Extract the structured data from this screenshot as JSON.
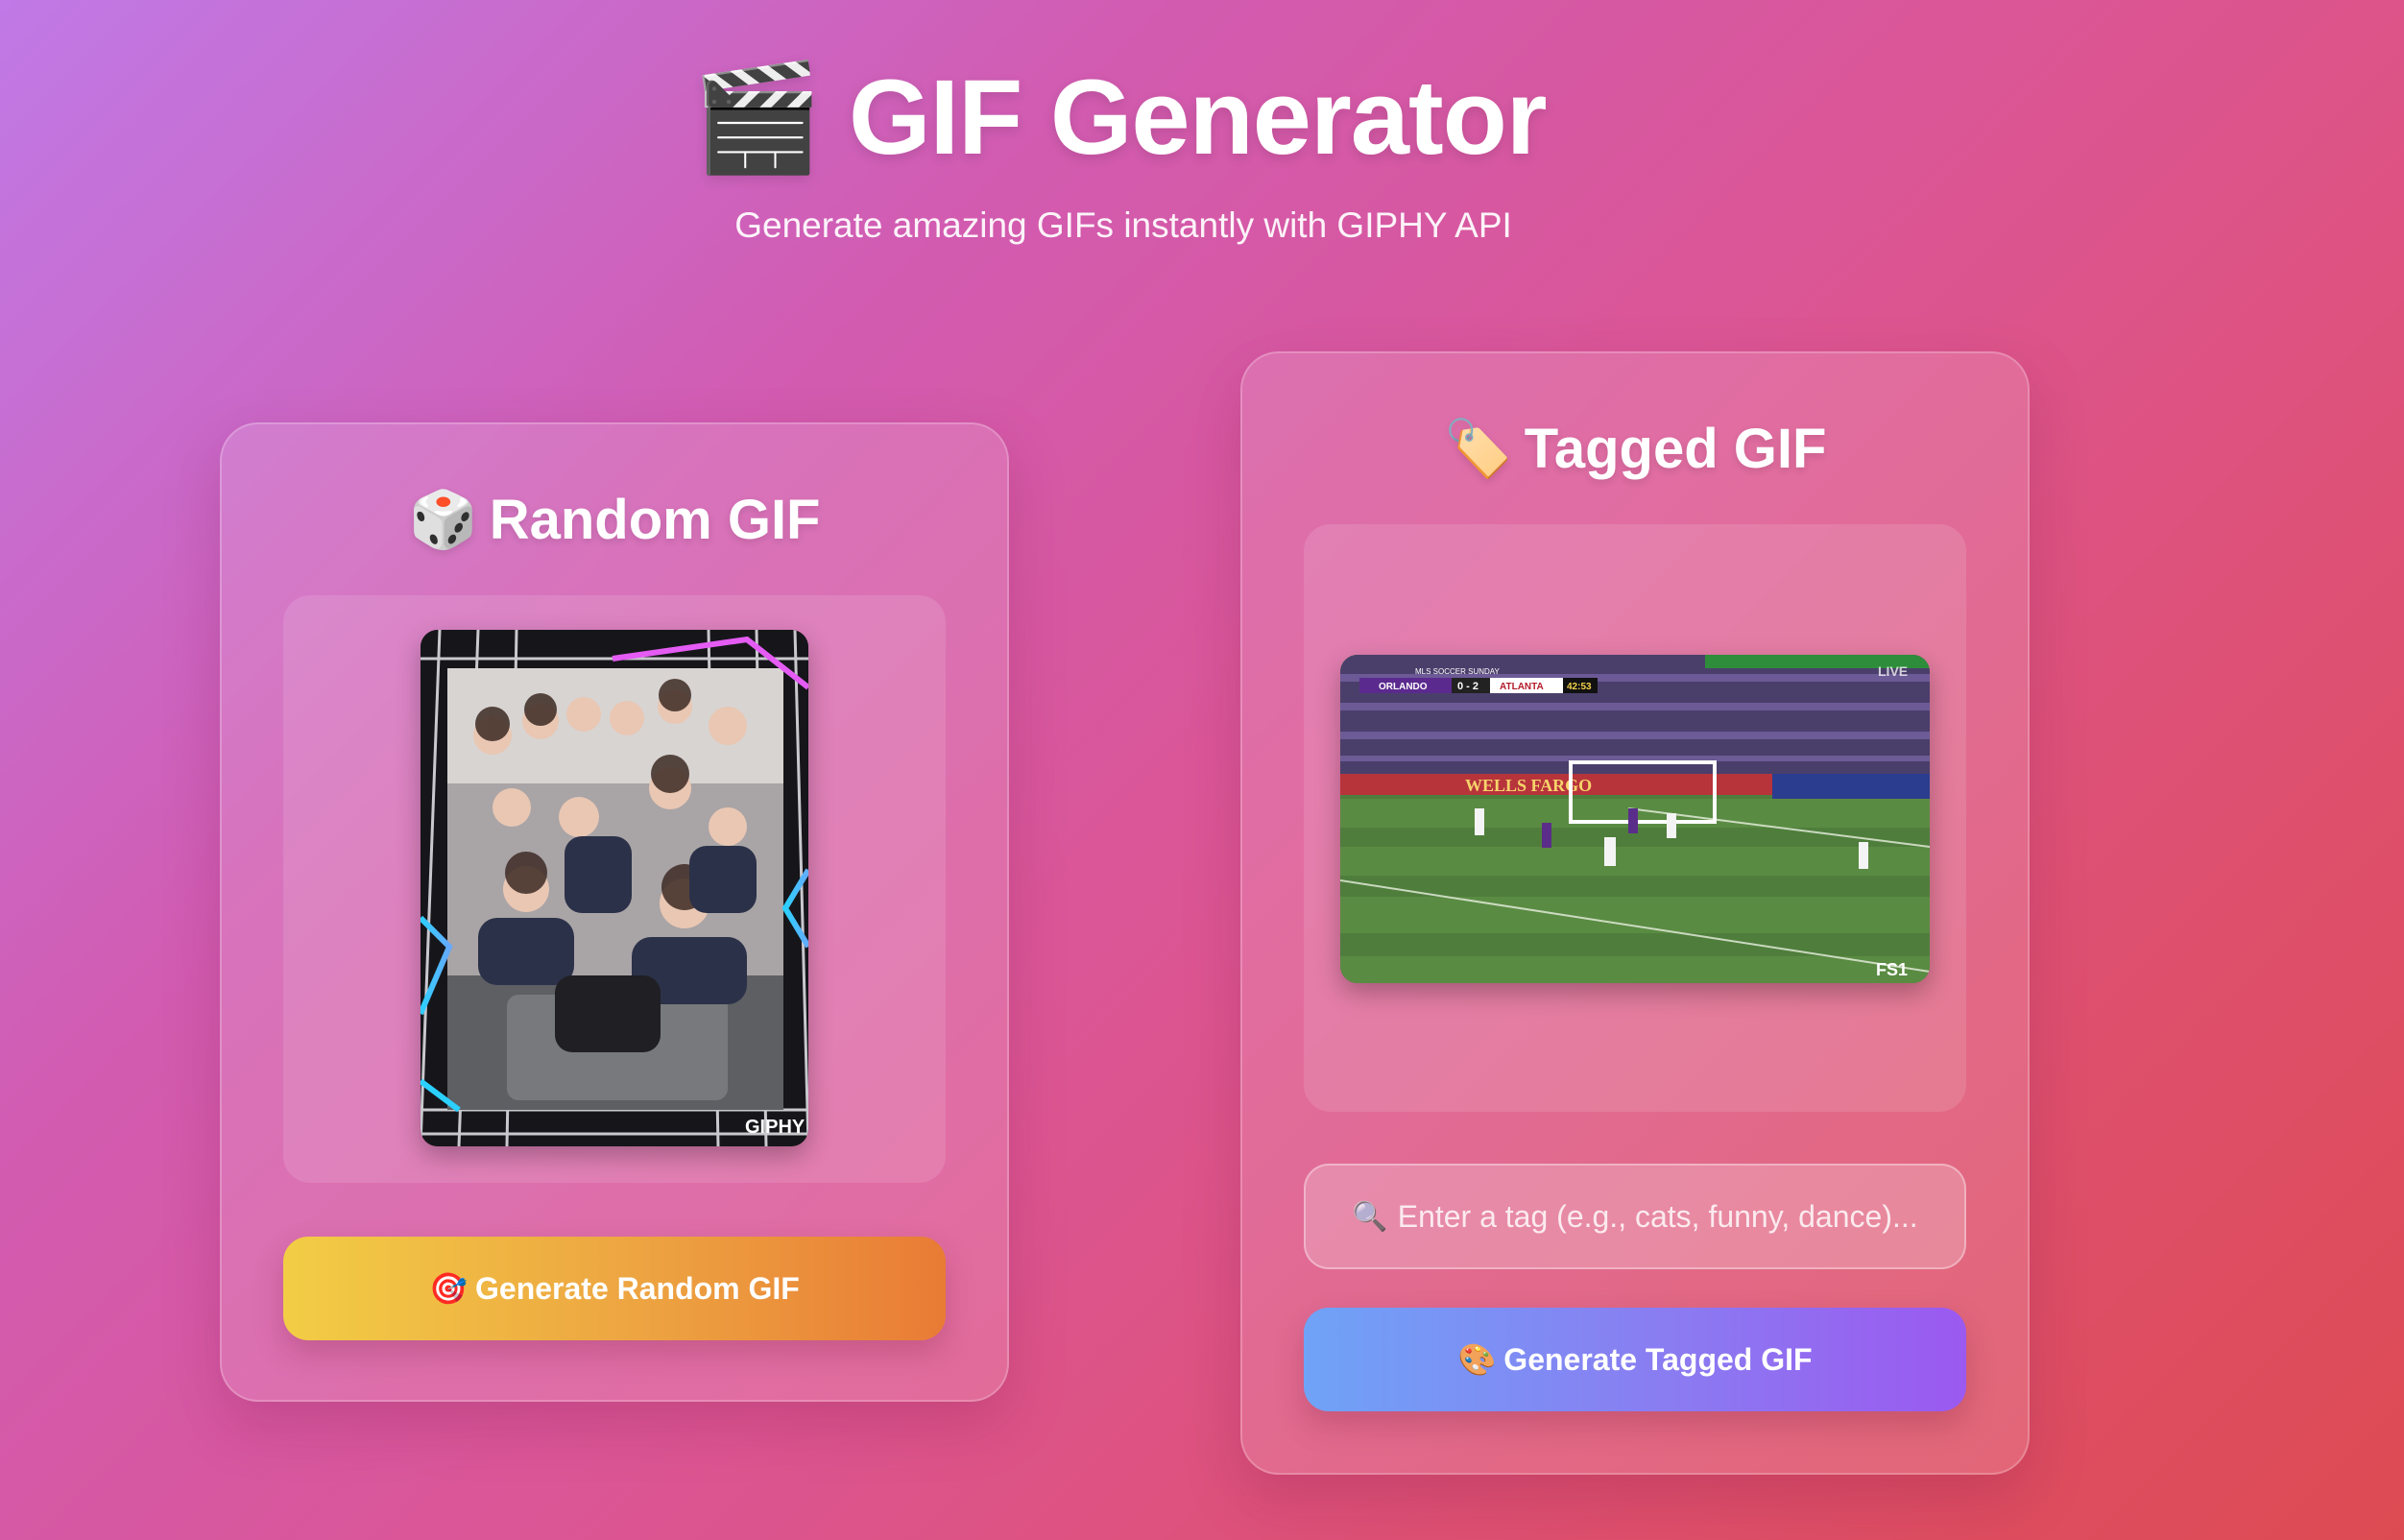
{
  "header": {
    "title_icon": "🎬",
    "title": "GIF Generator",
    "subtitle": "Generate amazing GIFs instantly with GIPHY API"
  },
  "random_card": {
    "title_icon": "🎲",
    "title": "Random GIF",
    "gif_watermark": "GIPHY",
    "button_icon": "🎯",
    "button_label": "Generate Random GIF"
  },
  "tagged_card": {
    "title_icon": "🏷️",
    "title": "Tagged GIF",
    "gif_scoreboard": {
      "league": "MLS SOCCER SUNDAY",
      "home": "ORLANDO",
      "score": "0 - 2",
      "away": "ATLANTA",
      "clock": "42:53",
      "live": "LIVE",
      "network": "FS1",
      "banner": "WELLS FARGO"
    },
    "input_icon": "🔍",
    "input_placeholder": "Enter a tag (e.g., cats, funny, dance)...",
    "button_icon": "🎨",
    "button_label": "Generate Tagged GIF"
  },
  "colors": {
    "random_button_start": "#f2cd45",
    "random_button_end": "#e97b35",
    "tagged_button_start": "#6fa3f7",
    "tagged_button_end": "#9b59f0"
  }
}
